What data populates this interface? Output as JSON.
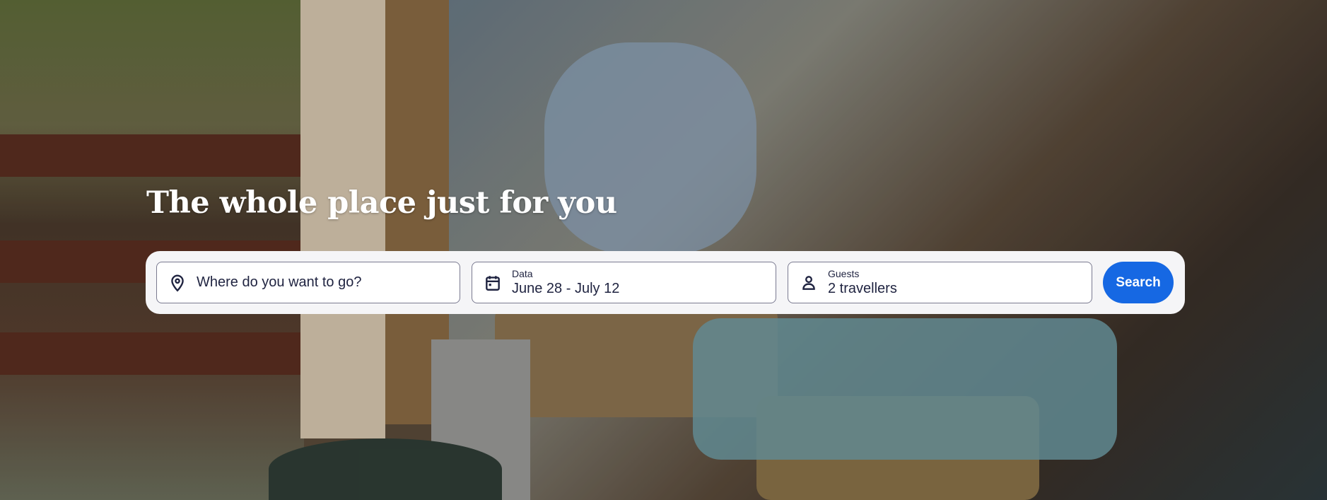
{
  "hero": {
    "heading": "The whole place just for you"
  },
  "search_bar": {
    "destination": {
      "placeholder": "Where do you want to go?",
      "icon": "map-pin-icon"
    },
    "dates": {
      "label": "Data",
      "value": "June 28 - July 12",
      "icon": "calendar-icon"
    },
    "guests": {
      "label": "Guests",
      "value": "2 travellers",
      "icon": "person-icon"
    },
    "search_label": "Search",
    "accent": "#1668e3"
  }
}
